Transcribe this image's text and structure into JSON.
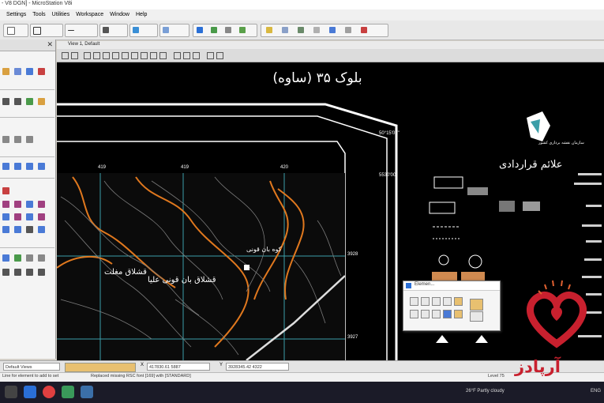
{
  "window": {
    "title": "- V8 DGN] - MicroStation V8i"
  },
  "menu": [
    "Settings",
    "Tools",
    "Utilities",
    "Workspace",
    "Window",
    "Help"
  ],
  "view": {
    "title": "View 1, Default"
  },
  "map": {
    "title": "بلوک ۳۵ (ساوه)",
    "legend_title": "علائم قراردادی",
    "org_name": "سازمان نقشه برداری کشور",
    "grid_labels": [
      "419",
      "419",
      "420",
      "3928",
      "3927",
      "5530'00\"",
      "50°15'00\""
    ],
    "places": [
      "قشلاق مغلت",
      "قشلاق بان قونی علیا",
      "کوه بان قونی"
    ]
  },
  "element_selection": {
    "title": "Elemen..."
  },
  "status": {
    "views_label": "Default Views",
    "x_label": "X",
    "x_value": "417830.61 5887",
    "y_label": "Y",
    "y_value": "3928345.42 4322",
    "level_label": "Level 75"
  },
  "messages": {
    "left": "Line for element to add to set",
    "center": "Replaced missing RSC font [169] with [STANDARD]"
  },
  "taskbar": {
    "weather": "26°F  Partly cloudy",
    "lang": "ENG"
  },
  "watermark": {
    "text": "آرپادز"
  },
  "colors": {
    "accent": "#2a6fd6",
    "contour": "#e0781e",
    "watermark": "#c8202e",
    "taskbar": "#1b1b28"
  }
}
